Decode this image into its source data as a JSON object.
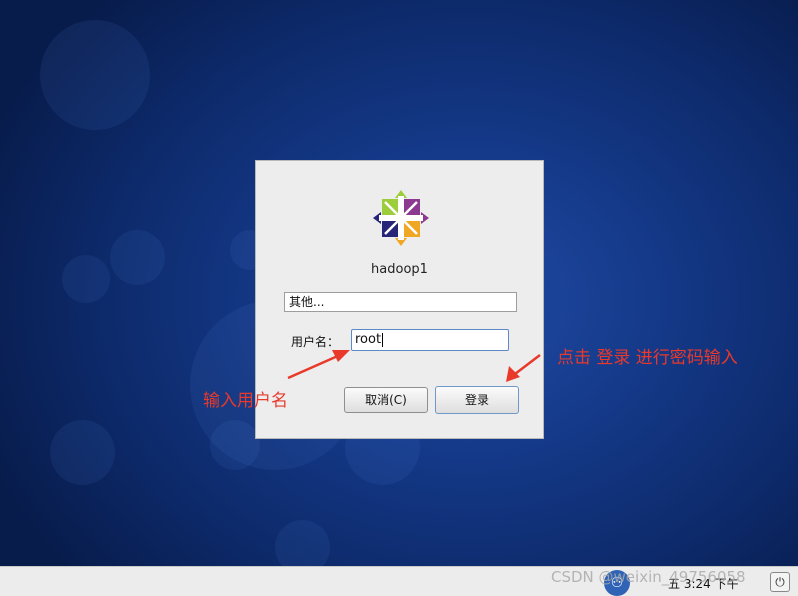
{
  "login_dialog": {
    "hostname": "hadoop1",
    "other_user_entry": "其他...",
    "username_label": "用户名：",
    "username_value": "root",
    "cancel_button": "取消(C)",
    "login_button": "登录"
  },
  "annotations": {
    "input_username": "输入用户名",
    "click_login": "点击 登录 进行密码输入"
  },
  "taskbar": {
    "clock": "五  3:24 下午"
  },
  "watermark": "CSDN @weixin_49756058",
  "colors": {
    "annotation": "#e8392b",
    "desktop_bg": "#153a8a",
    "dialog_bg": "#ededed"
  }
}
